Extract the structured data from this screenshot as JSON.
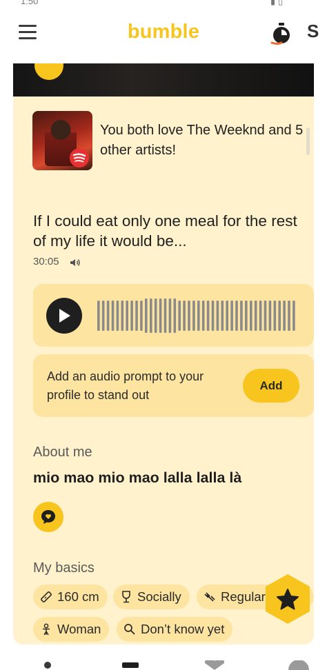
{
  "app": {
    "brand": "bumble",
    "brand_color": "#f8c51f",
    "clipped_right_header_char": "S"
  },
  "status_bar": {
    "left": "1:50",
    "right": "▮ ▯"
  },
  "header": {
    "menu_icon": "hamburger-menu-icon",
    "timer_icon": "stopwatch-icon"
  },
  "spotify": {
    "text": "You both love The Weeknd and 5 other artists!",
    "icon": "spotify-icon"
  },
  "prompt": {
    "question": "If I could eat only one meal for the rest of my life it would be...",
    "duration": "30:05",
    "progress": 0.0
  },
  "add_prompt": {
    "text": "Add an audio prompt to your profile to stand out",
    "button": "Add"
  },
  "about": {
    "title": "About me",
    "text": "mio mao mio mao lalla lalla là"
  },
  "basics": {
    "title": "My basics",
    "chips": [
      {
        "label": "160 cm",
        "icon": "ruler-icon"
      },
      {
        "label": "Socially",
        "icon": "wine-glass-icon"
      },
      {
        "label": "Regular",
        "icon": "dumbbell-icon"
      },
      {
        "label": "Woman",
        "icon": "gender-icon"
      },
      {
        "label": "Don’t know yet",
        "icon": "search-icon"
      }
    ]
  },
  "colors": {
    "card_bg": "#fff2cc",
    "chip_bg": "#fde5a1",
    "accent": "#f8c51f",
    "text": "#1f1f1f"
  },
  "bottom_nav": [
    "profile-icon",
    "discover-icon",
    "likes-icon",
    "chats-icon"
  ]
}
